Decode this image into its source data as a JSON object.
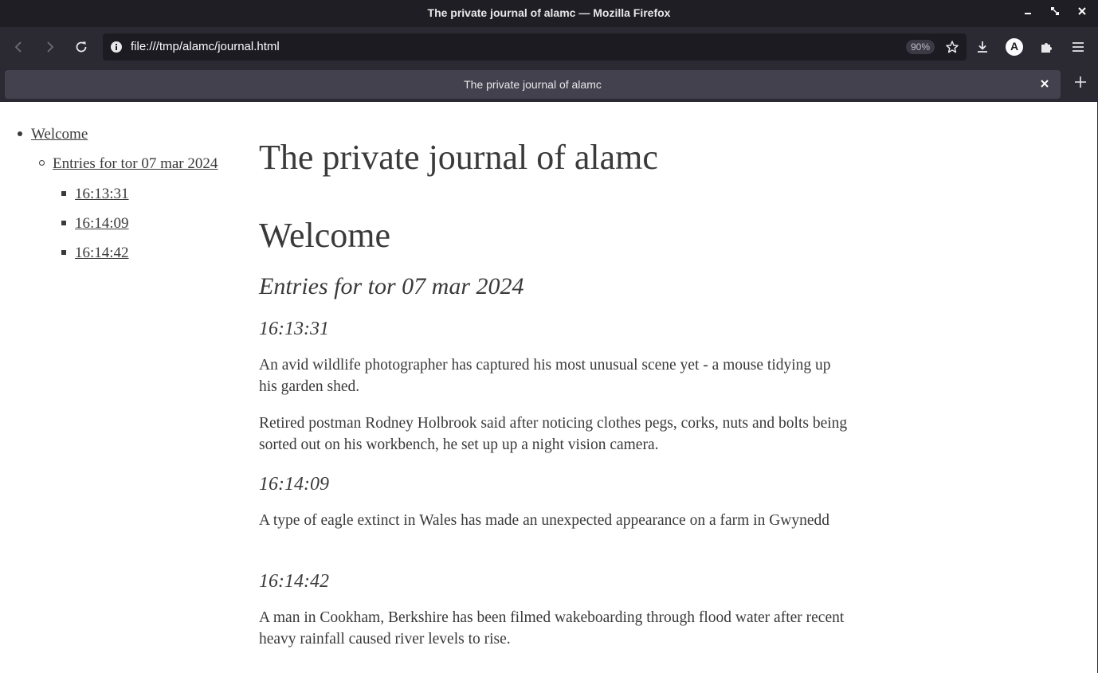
{
  "window": {
    "title": "The private journal of alamc — Mozilla Firefox"
  },
  "navbar": {
    "url": "file:///tmp/alamc/journal.html",
    "zoom": "90%",
    "account_initial": "A"
  },
  "tabs": [
    {
      "label": "The private journal of alamc"
    }
  ],
  "toc": {
    "welcome": "Welcome",
    "section": "Entries for tor 07 mar 2024",
    "entries": [
      "16:13:31",
      "16:14:09",
      "16:14:42"
    ]
  },
  "page": {
    "title": "The private journal of alamc",
    "welcome_heading": "Welcome",
    "section_heading": "Entries for tor 07 mar 2024",
    "entries": [
      {
        "time": "16:13:31",
        "paragraphs": [
          "An avid wildlife photographer has captured his most unusual scene yet - a mouse tidying up his garden shed.",
          "Retired postman Rodney Holbrook said after noticing clothes pegs, corks, nuts and bolts being sorted out on his workbench, he set up up a night vision camera."
        ]
      },
      {
        "time": "16:14:09",
        "paragraphs": [
          "A type of eagle extinct in Wales has made an unexpected appearance on a farm in Gwynedd"
        ]
      },
      {
        "time": "16:14:42",
        "paragraphs": [
          "A man in Cookham, Berkshire has been filmed wakeboarding through flood water after recent heavy rainfall caused river levels to rise."
        ]
      }
    ]
  }
}
